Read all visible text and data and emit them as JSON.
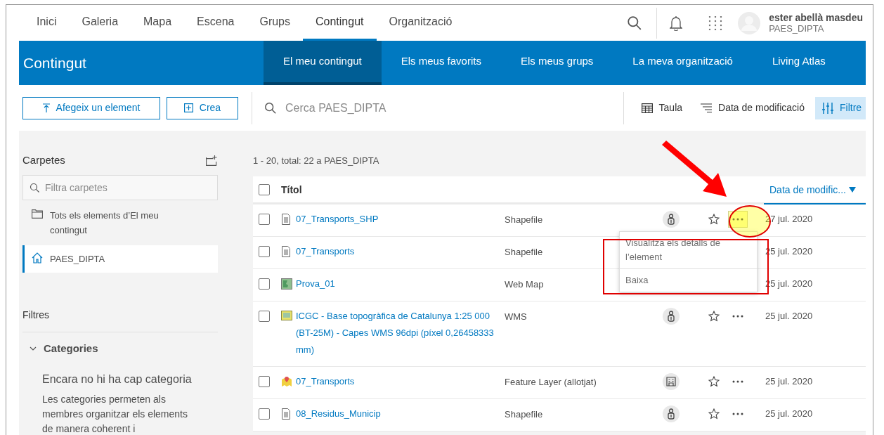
{
  "nav": {
    "tabs": [
      {
        "label": "Inici",
        "selected": false
      },
      {
        "label": "Galeria",
        "selected": false
      },
      {
        "label": "Mapa",
        "selected": false
      },
      {
        "label": "Escena",
        "selected": false
      },
      {
        "label": "Grups",
        "selected": false
      },
      {
        "label": "Contingut",
        "selected": true
      },
      {
        "label": "Organització",
        "selected": false
      }
    ],
    "user": {
      "name": "ester abellà masdeu",
      "org": "PAES_DIPTA"
    }
  },
  "header": {
    "title": "Contingut",
    "tabs": [
      {
        "label": "El meu contingut",
        "selected": true
      },
      {
        "label": "Els meus favorits",
        "selected": false
      },
      {
        "label": "Els meus grups",
        "selected": false
      },
      {
        "label": "La meva organització",
        "selected": false
      },
      {
        "label": "Living Atlas",
        "selected": false
      }
    ]
  },
  "toolbar": {
    "buttons": [
      {
        "label": "Afegeix un element",
        "kind": "upload"
      },
      {
        "label": "Crea",
        "kind": "plus"
      }
    ],
    "search": {
      "placeholder": "Cerca PAES_DIPTA"
    },
    "view": "Taula",
    "sort": "Data de modificació",
    "filter": {
      "label": "Filtre",
      "selected": true
    }
  },
  "sidebar": {
    "folders_title": "Carpetes",
    "folder_filter": {
      "placeholder": "Filtra carpetes"
    },
    "folders": [
      {
        "label": "Tots els elements d’El meu contingut",
        "kind": "folder",
        "selected": false
      },
      {
        "label": "PAES_DIPTA",
        "kind": "home",
        "selected": true
      }
    ],
    "filters_title": "Filtres",
    "categories": {
      "label": "Categories",
      "expanded": true,
      "empty_title": "Encara no hi ha cap categoria",
      "empty_text": "Les categories permeten als membres organitzar els elements de manera coherent i"
    }
  },
  "results": {
    "summary": "1 - 20, total: 22 a PAES_DIPTA",
    "select_all_checked": false,
    "columns": [
      {
        "label": "Títol",
        "sorted": false
      },
      {
        "label": "Data de modific...",
        "sorted": true
      }
    ],
    "rows": [
      {
        "title": "07_Transports_SHP",
        "kind": "document",
        "type": "Shapefile",
        "sharing": {
          "kind": "private"
        },
        "checked": false,
        "actions": true,
        "menu_open": true,
        "date": "27 jul. 2020"
      },
      {
        "title": "07_Transports",
        "kind": "document",
        "type": "Shapefile",
        "checked": false,
        "actions": false,
        "menu_open": false,
        "date": "25 jul. 2020"
      },
      {
        "title": "Prova_01",
        "kind": "webmap",
        "type": "Web Map",
        "checked": false,
        "actions": false,
        "menu_open": false,
        "date": "25 jul. 2020"
      },
      {
        "title": "ICGC - Base topogràfica de Catalunya 1:25 000 (BT-25M) - Capes WMS 96dpi (píxel 0,26458333 mm)",
        "kind": "wms",
        "type": "WMS",
        "sharing": {
          "kind": "private"
        },
        "checked": false,
        "actions": true,
        "menu_open": false,
        "date": "25 jul. 2020"
      },
      {
        "title": "07_Transports",
        "kind": "feature",
        "type": "Feature Layer (allotjat)",
        "sharing": {
          "kind": "organization"
        },
        "checked": false,
        "actions": true,
        "menu_open": false,
        "date": "25 jul. 2020"
      },
      {
        "title": "08_Residus_Municip",
        "kind": "document",
        "type": "Shapefile",
        "sharing": {
          "kind": "private"
        },
        "checked": false,
        "actions": true,
        "menu_open": false,
        "date": "25 jul. 2020"
      }
    ]
  },
  "menu": {
    "items": [
      "Visualitza els detalls de l’element",
      "Baixa"
    ]
  }
}
